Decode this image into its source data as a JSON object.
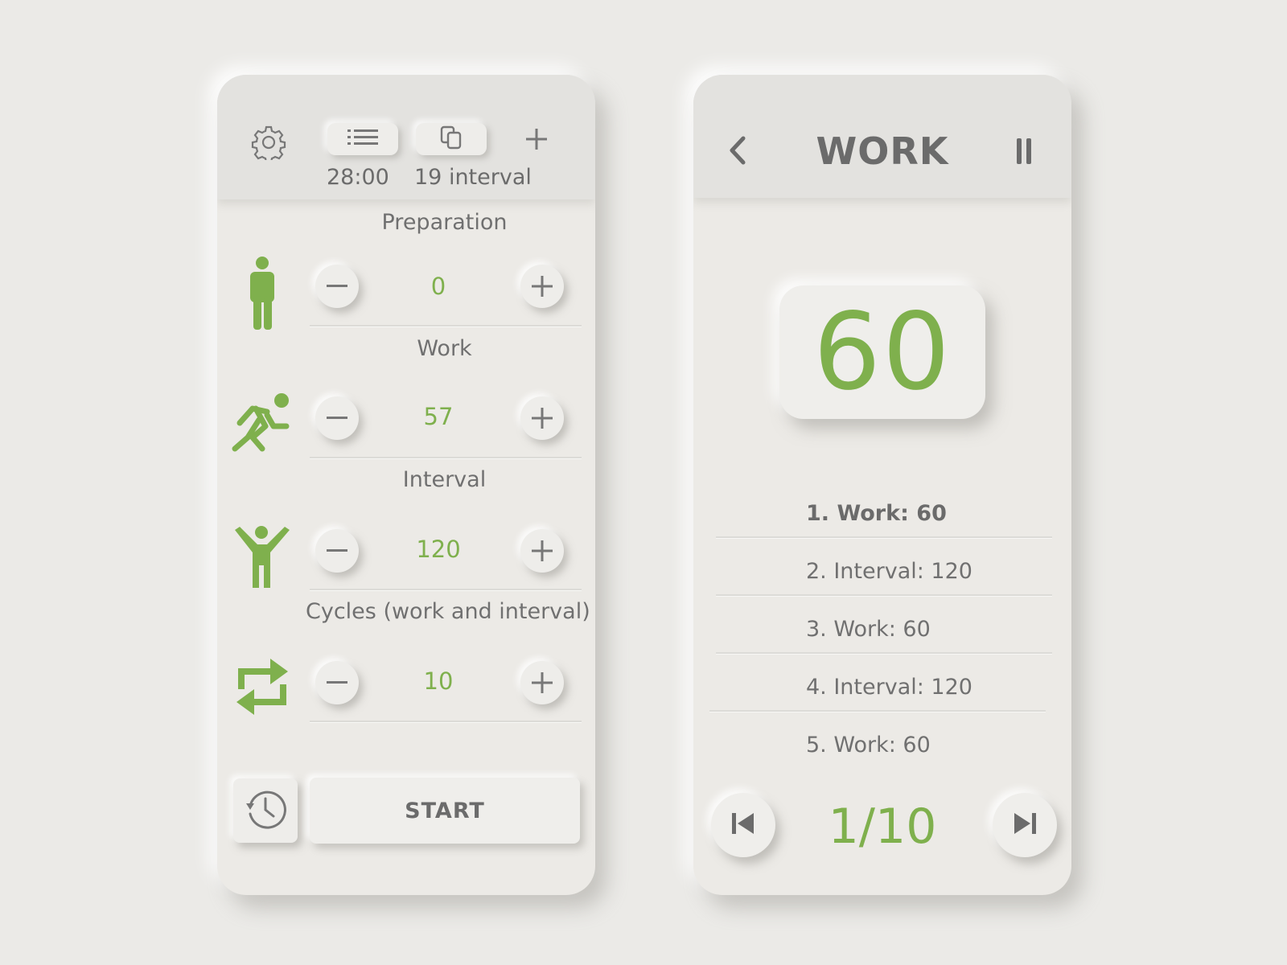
{
  "colors": {
    "background": "#ebeae7",
    "panel": "#eceae6",
    "header": "#e3e2df",
    "accent_green": "#7fb04d",
    "text_gray": "#6b6b6b"
  },
  "setup_screen": {
    "header": {
      "icons": [
        "gear-icon",
        "list-icon",
        "copy-icon",
        "plus-icon"
      ],
      "total_time": "28:00",
      "interval_count": "19 interval"
    },
    "rows": [
      {
        "label": "Preparation",
        "icon": "standing-person-icon",
        "value": "0"
      },
      {
        "label": "Work",
        "icon": "running-person-icon",
        "value": "57"
      },
      {
        "label": "Interval",
        "icon": "arms-up-person-icon",
        "value": "120"
      },
      {
        "label": "Cycles (work and interval)",
        "icon": "repeat-icon",
        "value": "10"
      }
    ],
    "history_icon": "history-icon",
    "start_label": "START"
  },
  "run_screen": {
    "mode_title": "WORK",
    "timer_value": "60",
    "sequence": [
      {
        "label": "1. Work: 60",
        "current": true
      },
      {
        "label": "2. Interval: 120",
        "current": false
      },
      {
        "label": "3. Work: 60",
        "current": false
      },
      {
        "label": "4. Interval: 120",
        "current": false
      },
      {
        "label": "5. Work: 60",
        "current": false
      }
    ],
    "progress_label": "1/10"
  }
}
